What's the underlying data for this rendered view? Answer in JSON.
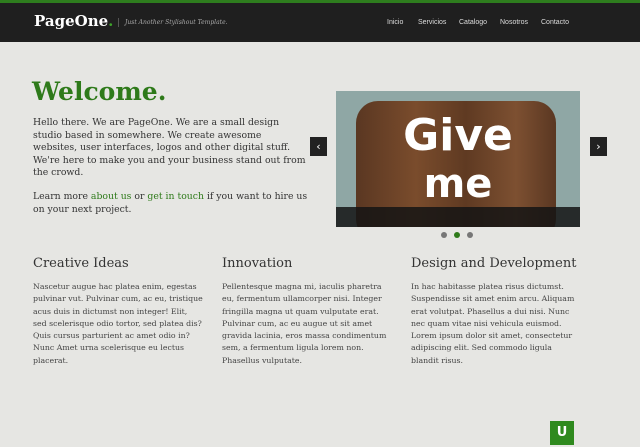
{
  "header": {
    "logo_text": "PageOne",
    "logo_dot": ".",
    "tagline": "Just Another Stylishout Template.",
    "nav": [
      "Inicio",
      "Servicios",
      "Catalogo",
      "Nosotros",
      "Contacto"
    ]
  },
  "hero": {
    "title": "Welcome",
    "title_dot": ".",
    "intro": "Hello there. We are PageOne. We are a small design studio based in somewhere. We create awesome websites, user interfaces, logos and other digital stuff. We're here to make you and your business stand out from the crowd.",
    "learn_prefix": "Learn more ",
    "learn_link1": "about us",
    "learn_mid": " or ",
    "learn_link2": "get in touch",
    "learn_suffix": " if you want to hire us on your next project."
  },
  "slider": {
    "line1": "Give",
    "line2": "me",
    "prev_label": "‹",
    "next_label": "›",
    "slides": 3,
    "active_slide": 2
  },
  "columns": [
    {
      "title": "Creative Ideas",
      "text": "Nascetur augue hac platea enim, egestas pulvinar vut. Pulvinar cum, ac eu, tristique acus duis in dictumst non integer! Elit, sed scelerisque odio tortor, sed platea dis? Quis cursus parturient ac amet odio in? Nunc Amet urna scelerisque eu lectus placerat."
    },
    {
      "title": "Innovation",
      "text": "Pellentesque magna mi, iaculis pharetra eu, fermentum ullamcorper nisi. Integer fringilla magna ut quam vulputate erat. Pulvinar cum, ac eu augue ut sit amet gravida lacinia, eros massa condimentum sem, a fermentum ligula lorem non. Phasellus vulputate."
    },
    {
      "title": "Design and Development",
      "text": "In hac habitasse platea risus dictumst. Suspendisse sit amet enim arcu. Aliquam erat volutpat. Phasellus a dui nisi. Nunc nec quam vitae nisi vehicula euismod. Lorem ipsum dolor sit amet, consectetur adipiscing elit. Sed commodo ligula blandit risus."
    }
  ],
  "back_to_top": "U",
  "colors": {
    "accent": "#2e7a1a",
    "header_bg": "#1f1f1f",
    "page_bg": "#e6e6e3"
  }
}
